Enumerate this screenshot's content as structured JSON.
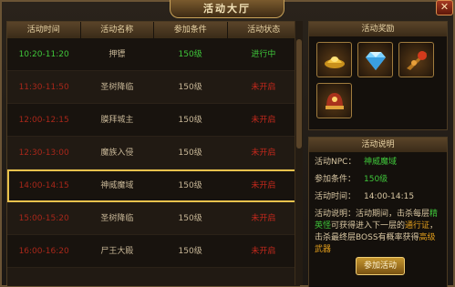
{
  "window": {
    "title": "活动大厅",
    "close_label": "✕"
  },
  "table": {
    "headers": [
      "活动时间",
      "活动名称",
      "参加条件",
      "活动状态"
    ],
    "rows": [
      {
        "time": "10:20-11:20",
        "name": "押镖",
        "level": "150级",
        "status": "进行中",
        "active": true
      },
      {
        "time": "11:30-11:50",
        "name": "圣树降临",
        "level": "150级",
        "status": "未开启"
      },
      {
        "time": "12:00-12:15",
        "name": "膜拜城主",
        "level": "150级",
        "status": "未开启"
      },
      {
        "time": "12:30-13:00",
        "name": "魔族入侵",
        "level": "150级",
        "status": "未开启"
      },
      {
        "time": "14:00-14:15",
        "name": "神威魔域",
        "level": "150级",
        "status": "未开启",
        "selected": true
      },
      {
        "time": "15:00-15:20",
        "name": "圣树降临",
        "level": "150级",
        "status": "未开启"
      },
      {
        "time": "16:00-16:20",
        "name": "尸王大殿",
        "level": "150级",
        "status": "未开启"
      },
      {
        "time": "",
        "name": "",
        "level": "",
        "status": ""
      }
    ]
  },
  "rewards": {
    "title": "活动奖励",
    "items": [
      "gold-ingot-icon",
      "diamond-icon",
      "dragon-weapon-icon",
      "helmet-icon"
    ]
  },
  "info": {
    "title": "活动说明",
    "npc_label": "活动NPC：",
    "npc_value": "神威魔域",
    "cond_label": "参加条件：",
    "cond_value": "150级",
    "time_label": "活动时间：",
    "time_value": "14:00-14:15",
    "desc_label": "活动说明：",
    "desc_1": "活动期间，击杀每层",
    "desc_2": "精英怪",
    "desc_3": "可获得进入下一层的",
    "desc_4": "通行证",
    "desc_5": "，击杀最终层BOSS有概率获得",
    "desc_6": "高级武器",
    "join_label": "参加活动"
  },
  "colors": {
    "active": "#3fc63a",
    "inactive": "#c2281c",
    "highlight": "#e8c24d"
  }
}
